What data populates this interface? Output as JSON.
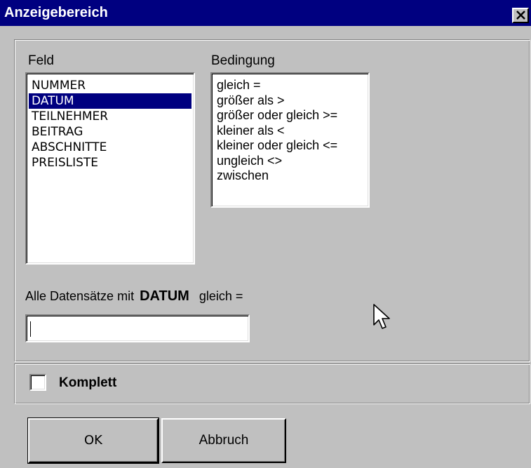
{
  "window": {
    "title": "Anzeigebereich"
  },
  "feld": {
    "label": "Feld",
    "items": [
      "NUMMER",
      "DATUM",
      "TEILNEHMER",
      "BEITRAG",
      "ABSCHNITTE",
      "PREISLISTE"
    ],
    "selected": "DATUM"
  },
  "bedingung": {
    "label": "Bedingung",
    "items": [
      "gleich  =",
      "größer als  >",
      "größer oder gleich >=",
      "kleiner als  <",
      "kleiner oder gleich  <=",
      "ungleich <>",
      "zwischen"
    ]
  },
  "summary": {
    "prefix": "Alle Datensätze mit",
    "field": "DATUM",
    "condition": "gleich  ="
  },
  "value_input": {
    "value": ""
  },
  "komplett": {
    "label": "Komplett",
    "checked": false
  },
  "buttons": {
    "ok_label": "OK",
    "cancel_label": "Abbruch"
  },
  "colors": {
    "titlebar": "#000080",
    "selection": "#000080",
    "face": "#c0c0c0"
  }
}
